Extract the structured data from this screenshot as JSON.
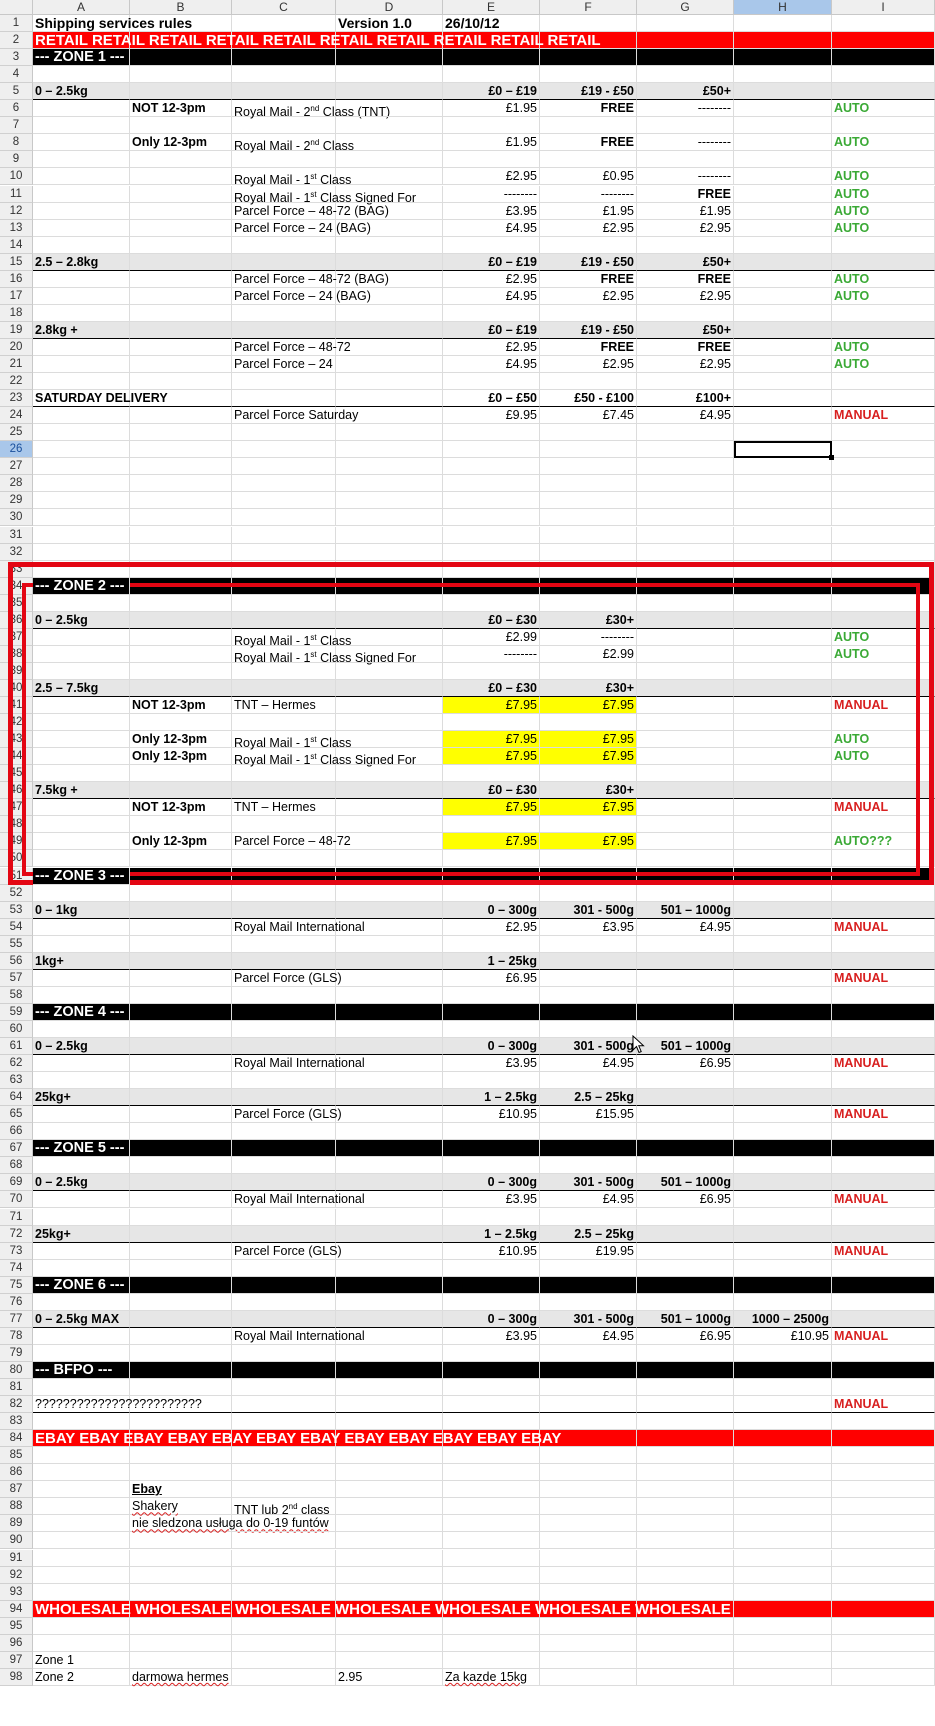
{
  "columns": [
    "A",
    "B",
    "C",
    "D",
    "E",
    "F",
    "G",
    "H",
    "I"
  ],
  "active_column": "H",
  "active_row": 26,
  "sheet": {
    "title": "Shipping services rules",
    "version": "Version 1.0",
    "date": "26/10/12",
    "retail_band": "RETAIL  RETAIL  RETAIL  RETAIL  RETAIL  RETAIL  RETAIL  RETAIL  RETAIL  RETAIL",
    "ebay_band": "EBAY  EBAY  EBAY  EBAY  EBAY  EBAY  EBAY  EBAY  EBAY  EBAY  EBAY  EBAY",
    "wholesale_band": "WHOLESALE  WHOLESALE  WHOLESALE  WHOLESALE  WHOLESALE  WHOLESALE  WHOLESALE",
    "zone1": {
      "header": "--- ZONE 1 ---",
      "w1": "0 – 2.5kg",
      "w1_cols": [
        "£0 – £19",
        "£19 - £50",
        "£50+"
      ],
      "r6": {
        "cond": "NOT 12-3pm",
        "svc": "Royal Mail - 2",
        "sup": "nd",
        "svc2": " Class (TNT)",
        "e": "£1.95",
        "f": "FREE",
        "g": "--------",
        "mode": "AUTO"
      },
      "r8": {
        "cond": "Only 12-3pm",
        "svc": "Royal Mail - 2",
        "sup": "nd",
        "svc2": " Class",
        "e": "£1.95",
        "f": "FREE",
        "g": "--------",
        "mode": "AUTO"
      },
      "r10": {
        "svc": "Royal Mail - 1",
        "sup": "st",
        "svc2": " Class",
        "e": "£2.95",
        "f": "£0.95",
        "g": "--------",
        "mode": "AUTO"
      },
      "r11": {
        "svc": "Royal Mail - 1",
        "sup": "st",
        "svc2": " Class Signed For",
        "e": "--------",
        "f": "--------",
        "g": "FREE",
        "mode": "AUTO"
      },
      "r12": {
        "svc": "Parcel Force – 48-72 (BAG)",
        "e": "£3.95",
        "f": "£1.95",
        "g": "£1.95",
        "mode": "AUTO"
      },
      "r13": {
        "svc": "Parcel Force – 24 (BAG)",
        "e": "£4.95",
        "f": "£2.95",
        "g": "£2.95",
        "mode": "AUTO"
      },
      "w2": "2.5 – 2.8kg",
      "w2_cols": [
        "£0 – £19",
        "£19 - £50",
        "£50+"
      ],
      "r16": {
        "svc": "Parcel Force – 48-72 (BAG)",
        "e": "£2.95",
        "f": "FREE",
        "g": "FREE",
        "mode": "AUTO"
      },
      "r17": {
        "svc": "Parcel Force – 24 (BAG)",
        "e": "£4.95",
        "f": "£2.95",
        "g": "£2.95",
        "mode": "AUTO"
      },
      "w3": "2.8kg +",
      "w3_cols": [
        "£0 – £19",
        "£19 - £50",
        "£50+"
      ],
      "r20": {
        "svc": "Parcel Force – 48-72",
        "e": "£2.95",
        "f": "FREE",
        "g": "FREE",
        "mode": "AUTO"
      },
      "r21": {
        "svc": "Parcel Force – 24",
        "e": "£4.95",
        "f": "£2.95",
        "g": "£2.95",
        "mode": "AUTO"
      },
      "sat": "SATURDAY DELIVERY",
      "sat_cols": [
        "£0 – £50",
        "£50 - £100",
        "£100+"
      ],
      "r24": {
        "svc": "Parcel Force Saturday",
        "e": "£9.95",
        "f": "£7.45",
        "g": "£4.95",
        "mode": "MANUAL"
      }
    },
    "zone2": {
      "header": "--- ZONE 2 ---",
      "w1": "0 – 2.5kg",
      "w1_cols": [
        "£0 – £30",
        "£30+"
      ],
      "r37": {
        "svc": "Royal Mail - 1",
        "sup": "st",
        "svc2": " Class",
        "e": "£2.99",
        "f": "--------",
        "mode": "AUTO"
      },
      "r38": {
        "svc": "Royal Mail - 1",
        "sup": "st",
        "svc2": " Class Signed For",
        "e": "--------",
        "f": "£2.99",
        "mode": "AUTO"
      },
      "w2": "2.5 – 7.5kg",
      "w2_cols": [
        "£0 – £30",
        "£30+"
      ],
      "r41": {
        "cond": "NOT 12-3pm",
        "svc": "TNT – Hermes",
        "e": "£7.95",
        "f": "£7.95",
        "mode": "MANUAL"
      },
      "r43": {
        "cond": "Only 12-3pm",
        "svc": "Royal Mail - 1",
        "sup": "st",
        "svc2": " Class",
        "e": "£7.95",
        "f": "£7.95",
        "mode": "AUTO"
      },
      "r44": {
        "cond": "Only 12-3pm",
        "svc": "Royal Mail - 1",
        "sup": "st",
        "svc2": " Class Signed For",
        "e": "£7.95",
        "f": "£7.95",
        "mode": "AUTO"
      },
      "w3": "7.5kg +",
      "w3_cols": [
        "£0 – £30",
        "£30+"
      ],
      "r47": {
        "cond": "NOT 12-3pm",
        "svc": "TNT – Hermes",
        "e": "£7.95",
        "f": "£7.95",
        "mode": "MANUAL"
      },
      "r49": {
        "cond": "Only 12-3pm",
        "svc": "Parcel Force – 48-72",
        "e": "£7.95",
        "f": "£7.95",
        "mode": "AUTO???"
      }
    },
    "zone3": {
      "header": "--- ZONE 3 ---",
      "w1": "0 – 1kg",
      "w1_cols": [
        "0 – 300g",
        "301 - 500g",
        "501 – 1000g"
      ],
      "r54": {
        "svc": "Royal Mail International",
        "e": "£2.95",
        "f": "£3.95",
        "g": "£4.95",
        "mode": "MANUAL"
      },
      "w2": "1kg+",
      "w2_cols": [
        "1 – 25kg"
      ],
      "r57": {
        "svc": "Parcel Force (GLS)",
        "e": "£6.95",
        "mode": "MANUAL"
      }
    },
    "zone4": {
      "header": "--- ZONE 4 ---",
      "w1": "0 – 2.5kg",
      "w1_cols": [
        "0 – 300g",
        "301 - 500g",
        "501 – 1000g"
      ],
      "r62": {
        "svc": "Royal Mail International",
        "e": "£3.95",
        "f": "£4.95",
        "g": "£6.95",
        "mode": "MANUAL"
      },
      "w2": "25kg+",
      "w2_cols": [
        "1 – 2.5kg",
        "2.5 – 25kg"
      ],
      "r65": {
        "svc": "Parcel Force (GLS)",
        "e": "£10.95",
        "f": "£15.95",
        "mode": "MANUAL"
      }
    },
    "zone5": {
      "header": "--- ZONE 5 ---",
      "w1": "0 – 2.5kg",
      "w1_cols": [
        "0 – 300g",
        "301 - 500g",
        "501 – 1000g"
      ],
      "r70": {
        "svc": "Royal Mail International",
        "e": "£3.95",
        "f": "£4.95",
        "g": "£6.95",
        "mode": "MANUAL"
      },
      "w2": "25kg+",
      "w2_cols": [
        "1 – 2.5kg",
        "2.5 – 25kg"
      ],
      "r73": {
        "svc": "Parcel Force (GLS)",
        "e": "£10.95",
        "f": "£19.95",
        "mode": "MANUAL"
      }
    },
    "zone6": {
      "header": "--- ZONE 6 ---",
      "w1": "0 – 2.5kg MAX",
      "w1_cols": [
        "0 – 300g",
        "301 - 500g",
        "501 – 1000g",
        "1000 – 2500g"
      ],
      "r78": {
        "svc": "Royal Mail International",
        "e": "£3.95",
        "f": "£4.95",
        "g": "£6.95",
        "h": "£10.95",
        "mode": "MANUAL"
      }
    },
    "bfpo": {
      "header": "--- BFPO ---",
      "r82": {
        "text": "????????????????????????",
        "mode": "MANUAL"
      }
    },
    "ebay": {
      "title": "Ebay",
      "r88_b": "Shakery",
      "r88_c": "TNT lub 2",
      "r88_sup": "nd",
      "r88_c2": " class",
      "r89": "nie sledzona usługa do 0-19 funtów"
    },
    "wholesale": {
      "r97_a": "Zone 1",
      "r98_a": "Zone 2",
      "r98_b": "darmowa hermes",
      "r98_d": "2.95",
      "r98_e": "Za kazde 15kg"
    }
  }
}
